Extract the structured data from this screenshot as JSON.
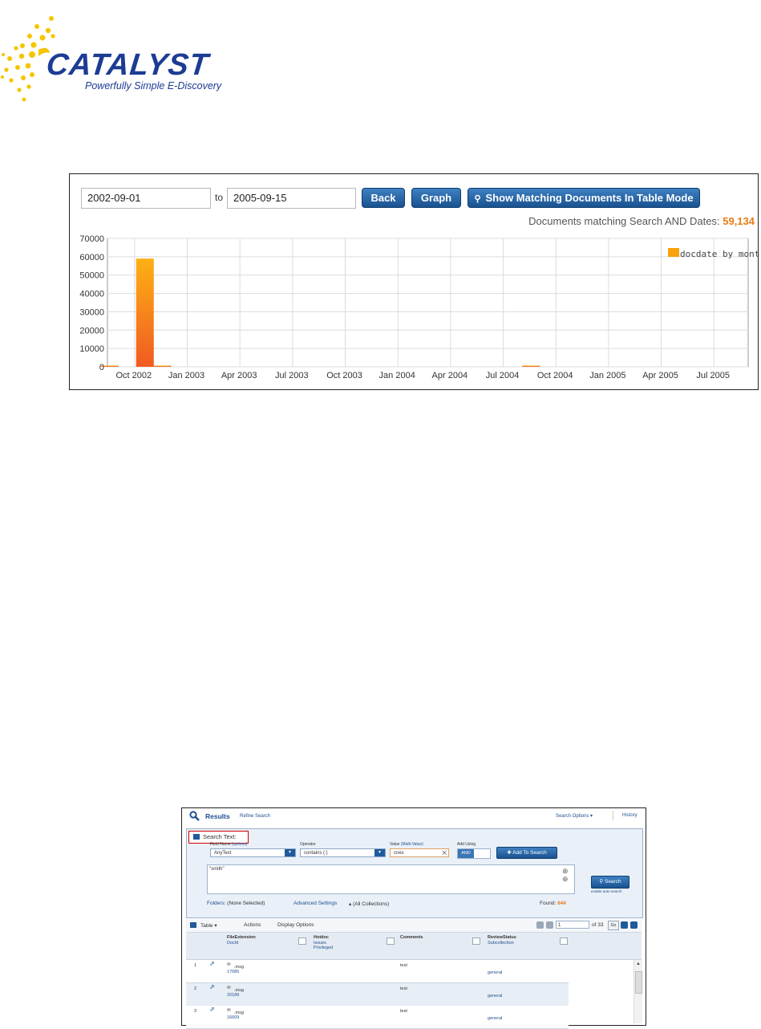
{
  "logo": {
    "name": "CATALYST",
    "tagline": "Powerfully Simple E-Discovery"
  },
  "date_range": {
    "from": "2002-09-01",
    "to_label": "to",
    "to": "2005-09-15"
  },
  "buttons": {
    "back": "Back",
    "graph": "Graph",
    "show_table": "Show Matching Documents In Table Mode"
  },
  "match_summary": {
    "label": "Documents matching Search AND Dates:",
    "count": "59,134"
  },
  "chart_data": {
    "type": "bar",
    "legend": "docdate by month",
    "legend_position": "top-right",
    "ylim": [
      0,
      70000
    ],
    "yticks": [
      "0",
      "10000",
      "20000",
      "30000",
      "40000",
      "50000",
      "60000",
      "70000"
    ],
    "xticks": [
      "Oct 2002",
      "Jan 2003",
      "Apr 2003",
      "Jul 2003",
      "Oct 2003",
      "Jan 2004",
      "Apr 2004",
      "Jul 2004",
      "Oct 2004",
      "Jan 2005",
      "Apr 2005",
      "Jul 2005"
    ],
    "categories": [
      "2002-09",
      "2002-10",
      "2002-11",
      "2002-12",
      "2003-01",
      "2003-02",
      "2003-03",
      "2003-04",
      "2003-05",
      "2003-06",
      "2003-07",
      "2003-08",
      "2003-09",
      "2003-10",
      "2003-11",
      "2003-12",
      "2004-01",
      "2004-02",
      "2004-03",
      "2004-04",
      "2004-05",
      "2004-06",
      "2004-07",
      "2004-08",
      "2004-09",
      "2004-10",
      "2004-11",
      "2004-12",
      "2005-01",
      "2005-02",
      "2005-03",
      "2005-04",
      "2005-05",
      "2005-06",
      "2005-07",
      "2005-08",
      "2005-09"
    ],
    "values": [
      300,
      0,
      59000,
      300,
      0,
      0,
      0,
      0,
      0,
      0,
      0,
      0,
      0,
      0,
      0,
      0,
      0,
      0,
      0,
      0,
      0,
      0,
      0,
      0,
      200,
      0,
      0,
      0,
      0,
      0,
      0,
      0,
      0,
      0,
      0,
      0,
      0
    ],
    "grid": true,
    "colors": {
      "bar_top": "#fdb114",
      "bar_bottom": "#f15a22",
      "legend": "#f7a20b"
    }
  },
  "results_screen": {
    "title": "Results",
    "refine": "Refine Search",
    "search_options": "Search Options",
    "history": "History",
    "search_text_label": "Search Text:",
    "field_name_label": "Field Name",
    "field_name_hint": "(options)",
    "field_name_value": "AnyText",
    "operator_label": "Operator",
    "operator_value": "contains (:)",
    "value_label": "Value",
    "value_hint": "(Multi-Value)",
    "value_value": "cnes",
    "add_using_label": "Add Using",
    "add_using_value": "AND",
    "add_to_search": "Add To Search",
    "query_text": "\"smith\"",
    "search_button": "Search",
    "auto_search": "enable auto-search",
    "folders_label": "Folders:",
    "folders_value": "(None Selected)",
    "advanced_settings": "Advanced Settings",
    "collections": "(All Collections)",
    "found_label": "Found:",
    "found_value": "644",
    "toolbar": {
      "table": "Table",
      "actions": "Actions",
      "display_options": "Display Options"
    },
    "pager": {
      "page": "1",
      "of": "of 33",
      "go": "Go"
    },
    "columns": [
      {
        "main": "FileExtension",
        "sub": "DocId",
        "sub2": ""
      },
      {
        "main": "Hotdoc",
        "sub": "Issues",
        "sub2": "Privileged"
      },
      {
        "main": "Comments",
        "sub": "",
        "sub2": ""
      },
      {
        "main": "ReviewStatus",
        "sub": "Subcollection",
        "sub2": ""
      }
    ],
    "rows": [
      {
        "n": "1",
        "ext": ".msg",
        "docid": "17685",
        "comment": "test",
        "subcollection": "general"
      },
      {
        "n": "2",
        "ext": ".msg",
        "docid": "20189",
        "comment": "test",
        "subcollection": "general"
      },
      {
        "n": "3",
        "ext": ".msg",
        "docid": "16609",
        "comment": "test",
        "subcollection": "general"
      }
    ]
  }
}
